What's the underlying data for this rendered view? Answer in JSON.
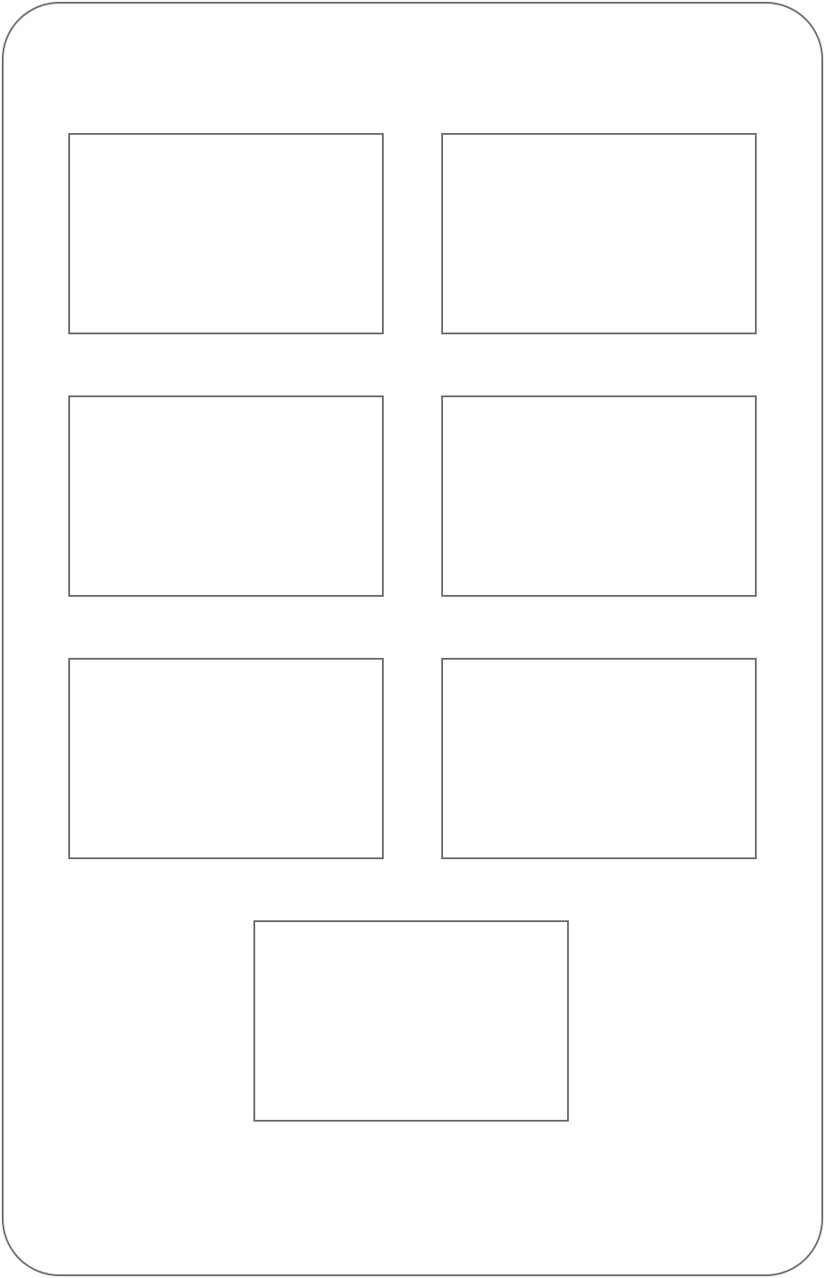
{
  "frame": {
    "border_color": "#6e6e6e",
    "background": "#fefefe"
  },
  "tiles": [
    {
      "label": ""
    },
    {
      "label": ""
    },
    {
      "label": ""
    },
    {
      "label": ""
    },
    {
      "label": ""
    },
    {
      "label": ""
    },
    {
      "label": ""
    }
  ]
}
